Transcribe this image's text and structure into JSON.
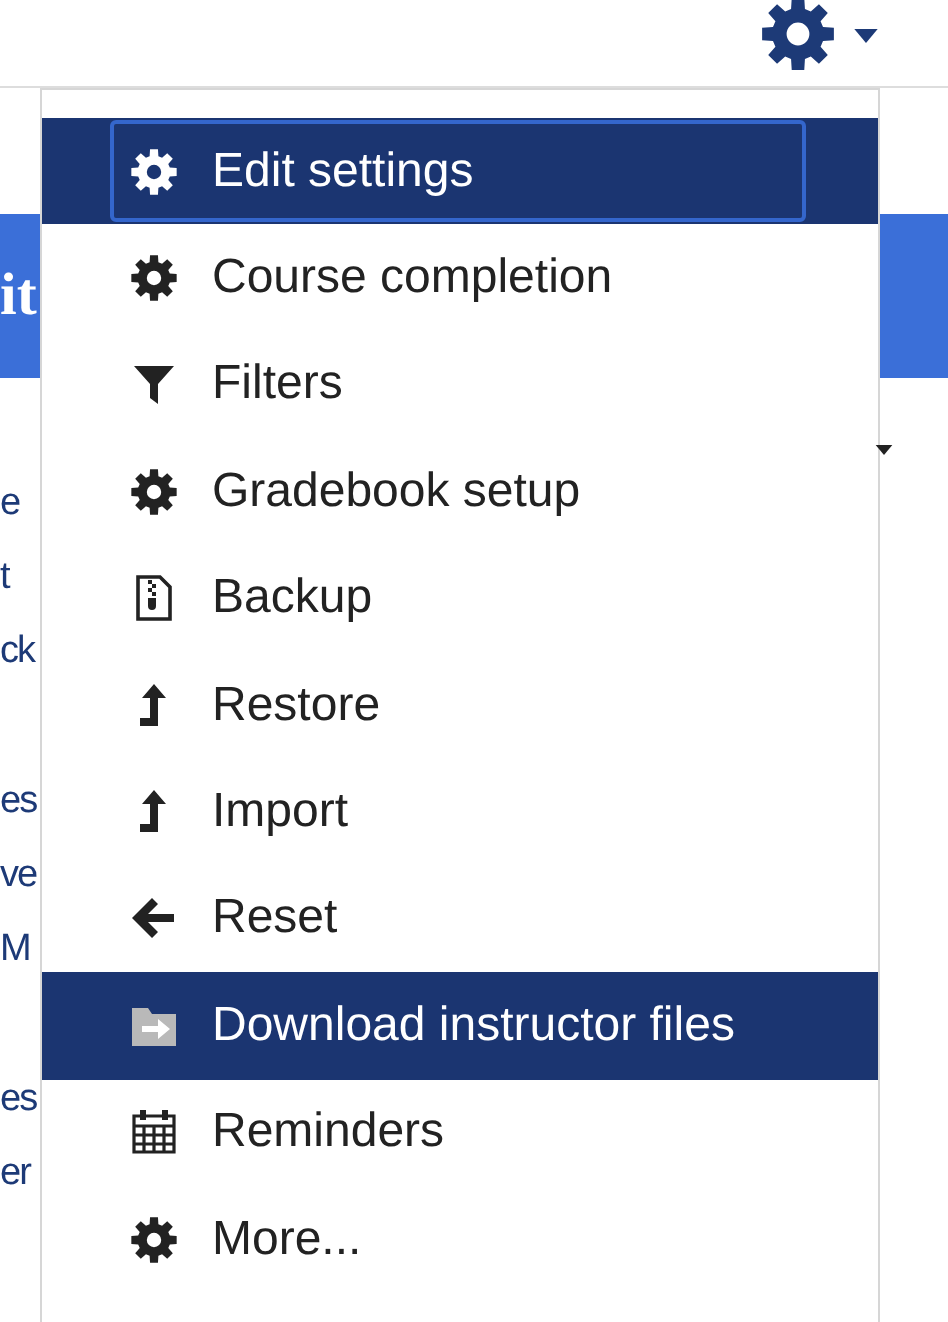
{
  "header": {
    "title_fragment": "it"
  },
  "page_fragments": [
    "e",
    "t",
    "ck",
    "es",
    "ve",
    "M",
    "es",
    "er"
  ],
  "settings_menu": {
    "items": [
      {
        "label": "Edit settings",
        "highlighted": true,
        "focused": true
      },
      {
        "label": "Course completion",
        "highlighted": false,
        "focused": false
      },
      {
        "label": "Filters",
        "highlighted": false,
        "focused": false
      },
      {
        "label": "Gradebook setup",
        "highlighted": false,
        "focused": false
      },
      {
        "label": "Backup",
        "highlighted": false,
        "focused": false
      },
      {
        "label": "Restore",
        "highlighted": false,
        "focused": false
      },
      {
        "label": "Import",
        "highlighted": false,
        "focused": false
      },
      {
        "label": "Reset",
        "highlighted": false,
        "focused": false
      },
      {
        "label": "Download instructor files",
        "highlighted": true,
        "focused": false
      },
      {
        "label": "Reminders",
        "highlighted": false,
        "focused": false
      },
      {
        "label": "More...",
        "highlighted": false,
        "focused": false
      }
    ]
  }
}
